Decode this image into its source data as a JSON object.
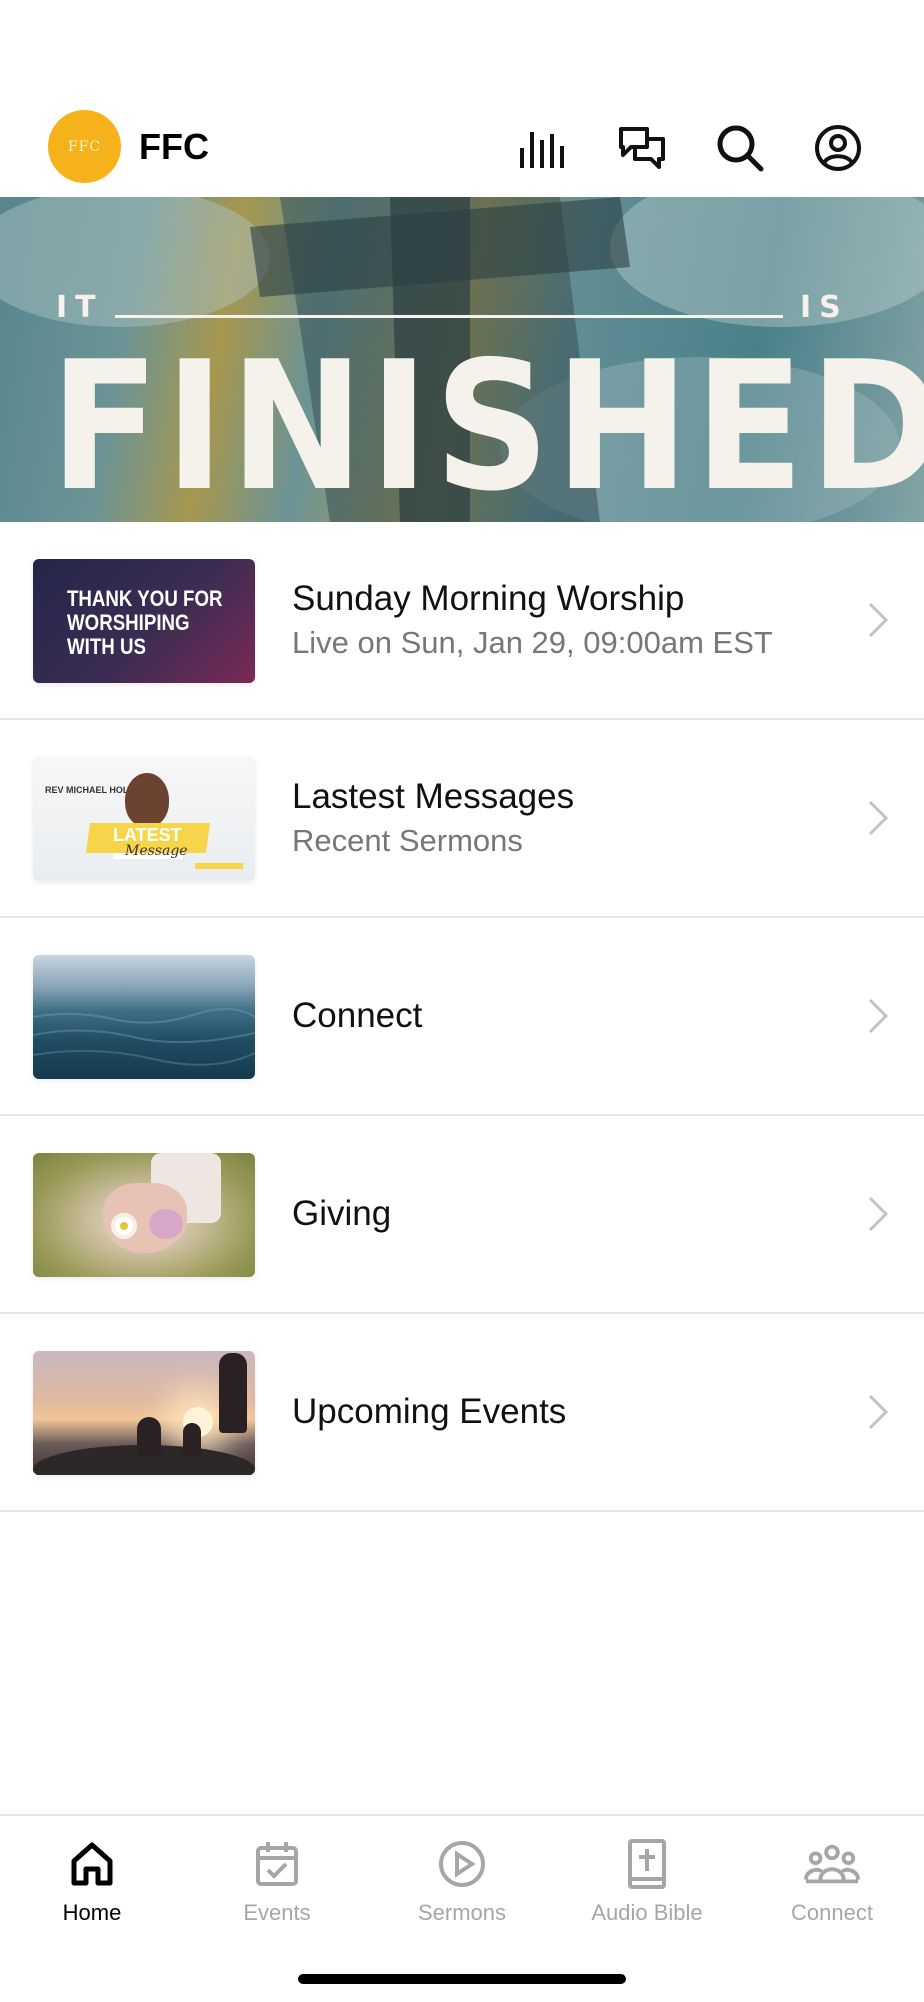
{
  "header": {
    "logo_text": "FFC",
    "app_name": "FFC",
    "icons": [
      "audio-bars-icon",
      "chat-icon",
      "search-icon",
      "profile-icon"
    ]
  },
  "banner": {
    "small_left": "IT",
    "small_right": "IS",
    "title": "FINISHED"
  },
  "list": {
    "items": [
      {
        "title": "Sunday Morning Worship",
        "subtitle": "Live on Sun, Jan 29, 09:00am EST",
        "thumb_text": "THANK YOU FOR WORSHIPING WITH US"
      },
      {
        "title": "Lastest Messages",
        "subtitle": "Recent Sermons",
        "thumb_name": "REV MICHAEL HOLT",
        "thumb_latest": "LATEST",
        "thumb_message": "Message"
      },
      {
        "title": "Connect",
        "subtitle": ""
      },
      {
        "title": "Giving",
        "subtitle": ""
      },
      {
        "title": "Upcoming Events",
        "subtitle": ""
      }
    ]
  },
  "tabbar": {
    "tabs": [
      {
        "label": "Home",
        "icon": "home-icon",
        "active": true
      },
      {
        "label": "Events",
        "icon": "calendar-check-icon",
        "active": false
      },
      {
        "label": "Sermons",
        "icon": "play-circle-icon",
        "active": false
      },
      {
        "label": "Audio Bible",
        "icon": "bible-icon",
        "active": false
      },
      {
        "label": "Connect",
        "icon": "group-icon",
        "active": false
      }
    ]
  },
  "colors": {
    "logo": "#f6b21a",
    "active_tab": "#000000",
    "inactive_tab": "#a6a6a6",
    "subtitle": "#777777"
  }
}
